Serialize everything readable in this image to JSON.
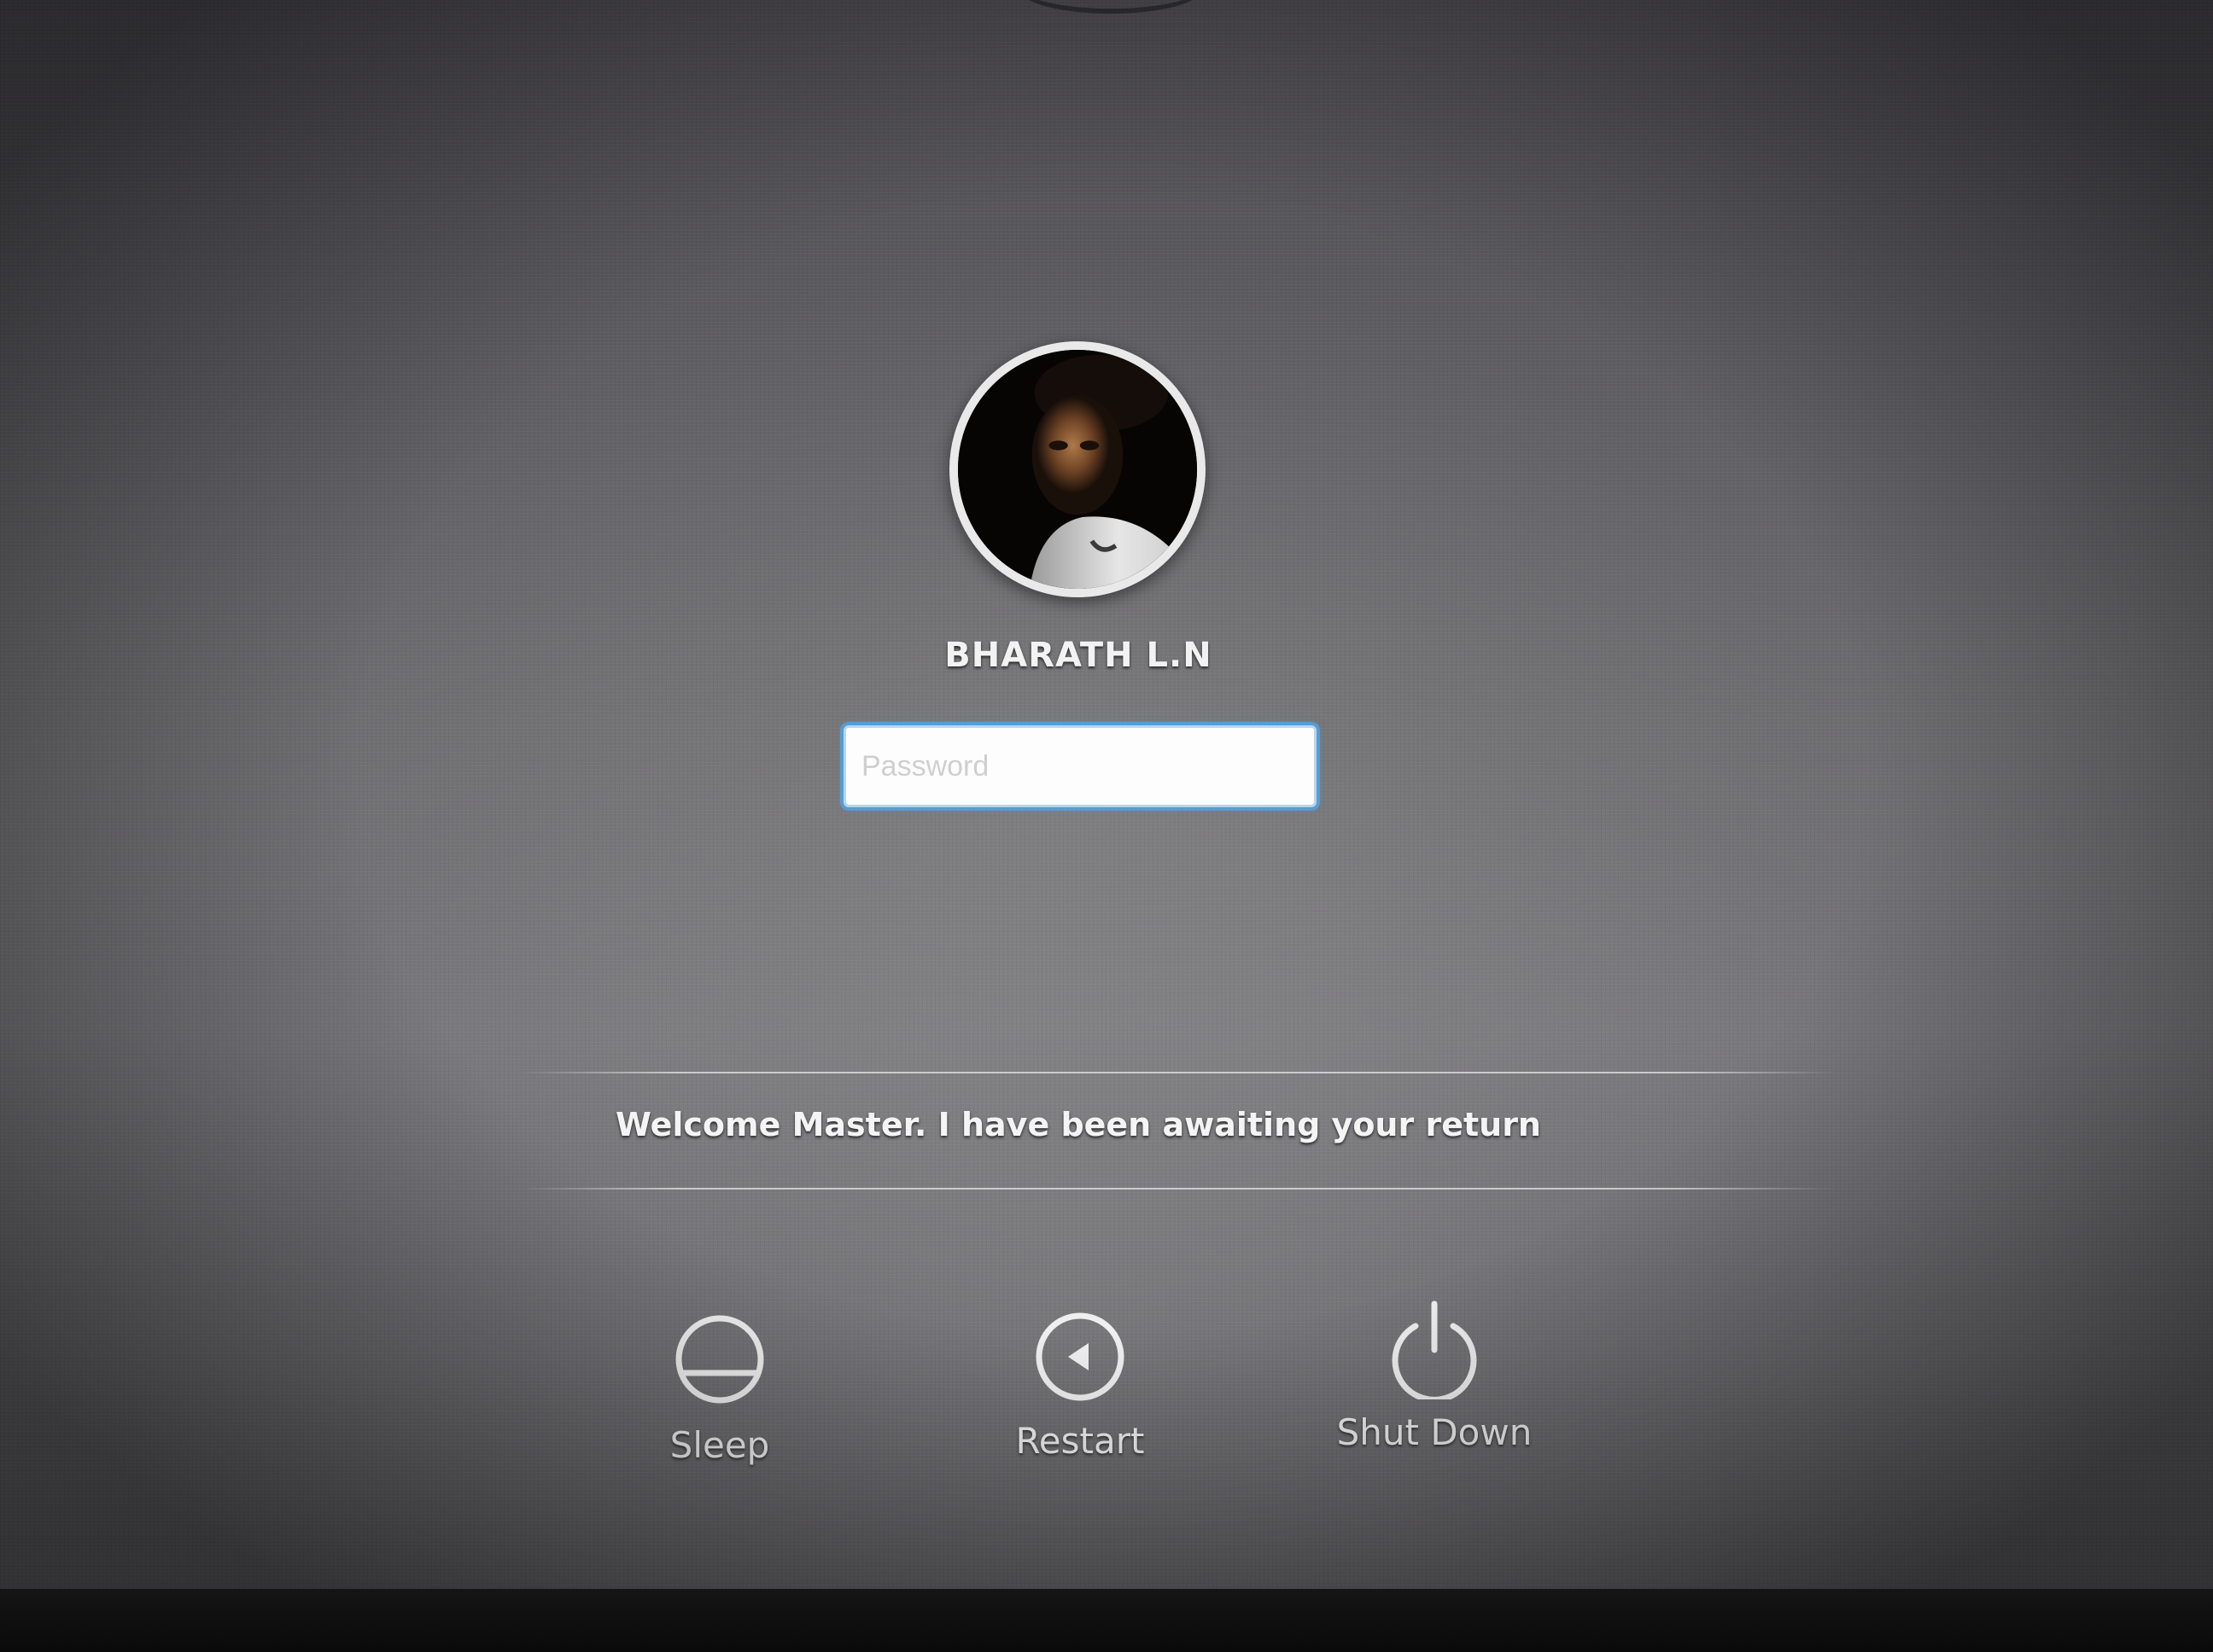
{
  "user": {
    "name": "BHARATH L.N"
  },
  "password": {
    "placeholder": "Password",
    "value": ""
  },
  "message": "Welcome Master. I have been awaiting your return",
  "actions": {
    "sleep": {
      "label": "Sleep",
      "icon": "sleep-icon"
    },
    "restart": {
      "label": "Restart",
      "icon": "restart-icon"
    },
    "shutdown": {
      "label": "Shut Down",
      "icon": "power-icon"
    }
  },
  "colors": {
    "focus_ring": "#54a1e2",
    "text": "#f2f2f2"
  }
}
